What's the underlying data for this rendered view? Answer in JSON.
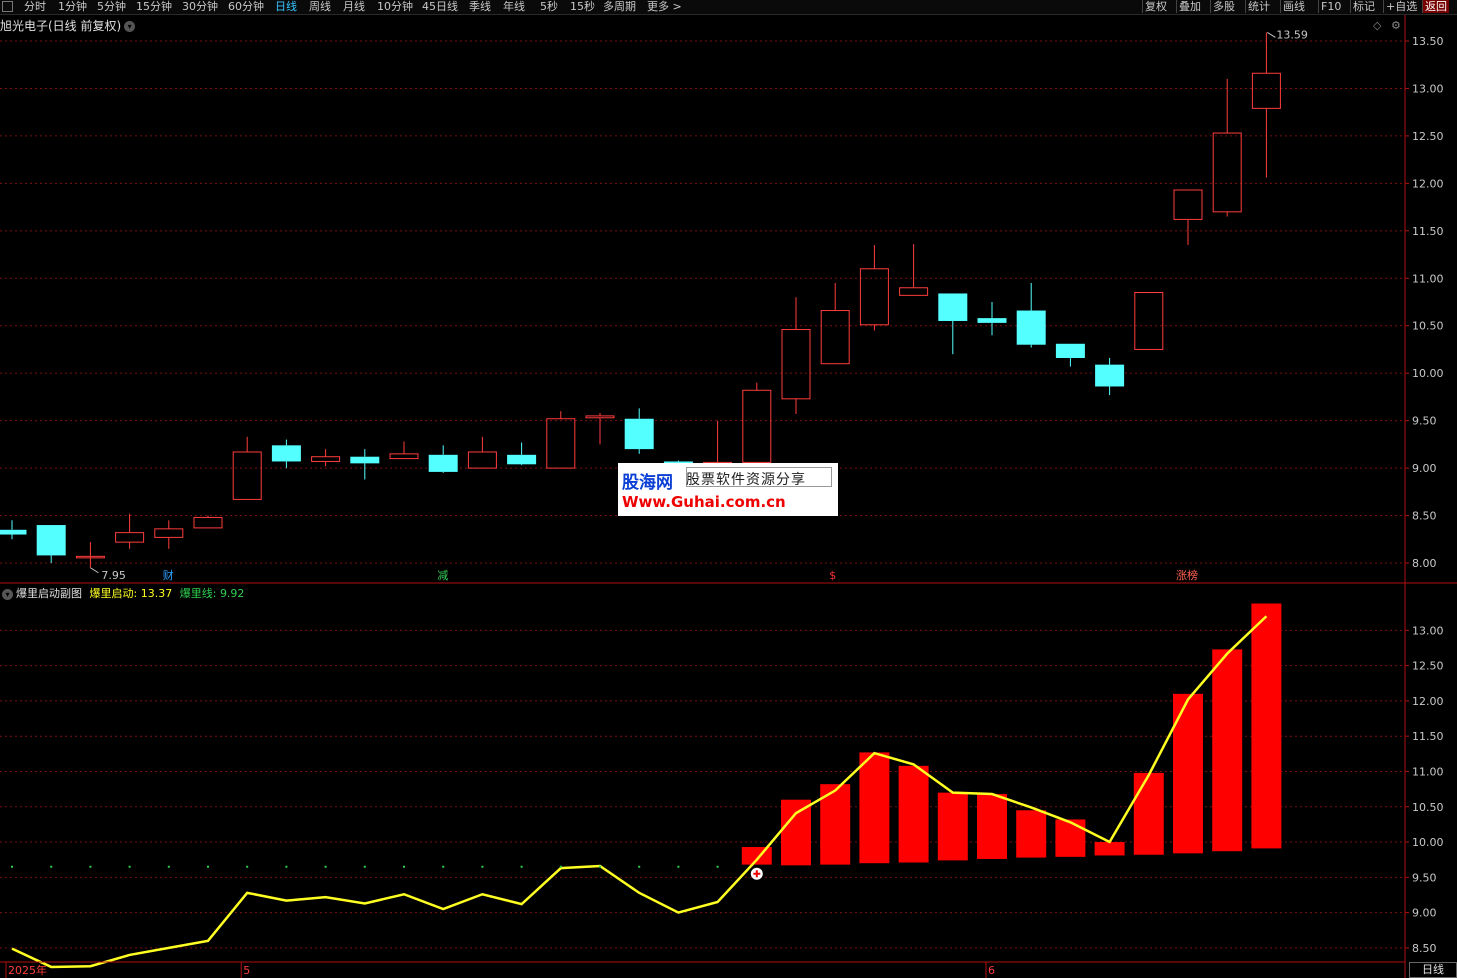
{
  "toolbar": {
    "periods": [
      "分时",
      "1分钟",
      "5分钟",
      "15分钟",
      "30分钟",
      "60分钟",
      "日线",
      "周线",
      "月线",
      "10分钟",
      "45日线",
      "季线",
      "年线",
      "5秒",
      "15秒",
      "多周期",
      "更多 >"
    ],
    "active_period": "日线",
    "right_tools": [
      "复权",
      "叠加",
      "多股",
      "统计",
      "画线",
      "F10",
      "标记",
      "+自选",
      "返回"
    ]
  },
  "main": {
    "title": "旭光电子(日线 前复权)",
    "high_marker": "13.59",
    "low_marker": "7.95",
    "event_markers": [
      {
        "label": "财",
        "color": "#2fa0ff",
        "index": 4
      },
      {
        "label": "减",
        "color": "#2fcc55",
        "index": 11
      },
      {
        "label": "$",
        "color": "#ff3030",
        "index": 21
      },
      {
        "label": "涨榜",
        "color": "#ff6050",
        "index": 30
      }
    ]
  },
  "sub": {
    "title": "爆里启动副图",
    "line1_label": "爆里启动:",
    "line1_value": "13.37",
    "line2_label": "爆里线:",
    "line2_value": "9.92"
  },
  "x_axis": {
    "labels": [
      {
        "text": "2025年",
        "index": 0
      },
      {
        "text": "5",
        "index": 6
      },
      {
        "text": "6",
        "index": 25
      }
    ],
    "period_button": "日线"
  },
  "watermark": {
    "logo": "股海网",
    "subtitle": "股票软件资源分享",
    "url": "Www.Guhai.com.cn"
  },
  "colors": {
    "up": "#ff3c3c",
    "down": "#54ffff",
    "grid": "#7a1010",
    "line": "#ffff22",
    "bar": "#ff0000",
    "dots": "#2fd04f"
  },
  "chart_data": [
    {
      "type": "candlestick",
      "title": "旭光电子(日线 前复权)",
      "ylim": [
        7.8,
        13.7
      ],
      "yticks": [
        8.0,
        8.5,
        9.0,
        9.5,
        10.0,
        10.5,
        11.0,
        11.5,
        12.0,
        12.5,
        13.0,
        13.5
      ],
      "candles": [
        {
          "o": 8.35,
          "h": 8.45,
          "l": 8.25,
          "c": 8.3
        },
        {
          "o": 8.4,
          "h": 8.4,
          "l": 8.0,
          "c": 8.08
        },
        {
          "o": 8.07,
          "h": 8.22,
          "l": 7.95,
          "c": 8.07
        },
        {
          "o": 8.22,
          "h": 8.52,
          "l": 8.15,
          "c": 8.32
        },
        {
          "o": 8.27,
          "h": 8.45,
          "l": 8.15,
          "c": 8.36
        },
        {
          "o": 8.37,
          "h": 8.5,
          "l": 8.37,
          "c": 8.48
        },
        {
          "o": 8.67,
          "h": 9.33,
          "l": 8.67,
          "c": 9.17
        },
        {
          "o": 9.24,
          "h": 9.3,
          "l": 9.0,
          "c": 9.07
        },
        {
          "o": 9.07,
          "h": 9.2,
          "l": 9.02,
          "c": 9.12
        },
        {
          "o": 9.12,
          "h": 9.2,
          "l": 8.88,
          "c": 9.05
        },
        {
          "o": 9.1,
          "h": 9.28,
          "l": 9.1,
          "c": 9.15
        },
        {
          "o": 9.14,
          "h": 9.24,
          "l": 8.95,
          "c": 8.96
        },
        {
          "o": 9.0,
          "h": 9.33,
          "l": 9.0,
          "c": 9.17
        },
        {
          "o": 9.14,
          "h": 9.27,
          "l": 9.03,
          "c": 9.04
        },
        {
          "o": 9.0,
          "h": 9.6,
          "l": 9.0,
          "c": 9.52
        },
        {
          "o": 9.53,
          "h": 9.58,
          "l": 9.25,
          "c": 9.55
        },
        {
          "o": 9.52,
          "h": 9.63,
          "l": 9.15,
          "c": 9.2
        },
        {
          "o": 9.07,
          "h": 9.08,
          "l": 8.94,
          "c": 9.01
        },
        {
          "o": 9.0,
          "h": 9.5,
          "l": 9.0,
          "c": 9.06
        },
        {
          "o": 9.06,
          "h": 9.9,
          "l": 9.06,
          "c": 9.82
        },
        {
          "o": 9.73,
          "h": 10.8,
          "l": 9.57,
          "c": 10.46
        },
        {
          "o": 10.1,
          "h": 10.95,
          "l": 10.1,
          "c": 10.66
        },
        {
          "o": 10.51,
          "h": 11.35,
          "l": 10.45,
          "c": 11.1
        },
        {
          "o": 10.82,
          "h": 11.36,
          "l": 10.82,
          "c": 10.9
        },
        {
          "o": 10.84,
          "h": 10.84,
          "l": 10.2,
          "c": 10.55
        },
        {
          "o": 10.58,
          "h": 10.75,
          "l": 10.4,
          "c": 10.53
        },
        {
          "o": 10.66,
          "h": 10.95,
          "l": 10.27,
          "c": 10.3
        },
        {
          "o": 10.31,
          "h": 10.31,
          "l": 10.07,
          "c": 10.16
        },
        {
          "o": 10.09,
          "h": 10.16,
          "l": 9.77,
          "c": 9.86
        },
        {
          "o": 10.25,
          "h": 10.85,
          "l": 10.25,
          "c": 10.85
        },
        {
          "o": 11.62,
          "h": 11.93,
          "l": 11.35,
          "c": 11.93
        },
        {
          "o": 11.7,
          "h": 13.1,
          "l": 11.65,
          "c": 12.53
        },
        {
          "o": 12.79,
          "h": 13.59,
          "l": 12.06,
          "c": 13.16
        }
      ]
    },
    {
      "type": "bar+line",
      "title": "爆里启动副图",
      "ylim": [
        8.3,
        13.6
      ],
      "yticks": [
        8.5,
        9.0,
        9.5,
        10.0,
        10.5,
        11.0,
        11.5,
        12.0,
        12.5,
        13.0
      ],
      "series": [
        {
          "name": "爆里启动",
          "type": "line",
          "values": [
            8.49,
            8.23,
            8.24,
            8.4,
            8.5,
            8.6,
            9.28,
            9.17,
            9.22,
            9.13,
            9.26,
            9.05,
            9.26,
            9.12,
            9.63,
            9.66,
            9.28,
            9.0,
            9.15,
            9.75,
            10.41,
            10.73,
            11.26,
            11.1,
            10.7,
            10.68,
            10.49,
            10.28,
            10.0,
            10.95,
            12.02,
            12.67,
            13.2
          ]
        },
        {
          "name": "爆里线",
          "type": "dots",
          "values": [
            9.65,
            9.65,
            9.65,
            9.65,
            9.65,
            9.65,
            9.65,
            9.65,
            9.65,
            9.65,
            9.65,
            9.65,
            9.65,
            9.65,
            9.65,
            9.65,
            9.65,
            9.65,
            9.65
          ]
        },
        {
          "name": "bars",
          "type": "bar",
          "bars": [
            {
              "index": 19,
              "bottom": 9.68,
              "top": 9.93
            },
            {
              "index": 20,
              "bottom": 9.67,
              "top": 10.6
            },
            {
              "index": 21,
              "bottom": 9.68,
              "top": 10.82
            },
            {
              "index": 22,
              "bottom": 9.7,
              "top": 11.27
            },
            {
              "index": 23,
              "bottom": 9.71,
              "top": 11.08
            },
            {
              "index": 24,
              "bottom": 9.74,
              "top": 10.7
            },
            {
              "index": 25,
              "bottom": 9.76,
              "top": 10.68
            },
            {
              "index": 26,
              "bottom": 9.78,
              "top": 10.45
            },
            {
              "index": 27,
              "bottom": 9.79,
              "top": 10.32
            },
            {
              "index": 28,
              "bottom": 9.81,
              "top": 10.0
            },
            {
              "index": 29,
              "bottom": 9.82,
              "top": 10.98
            },
            {
              "index": 30,
              "bottom": 9.84,
              "top": 12.1
            },
            {
              "index": 31,
              "bottom": 9.87,
              "top": 12.73
            },
            {
              "index": 32,
              "bottom": 9.91,
              "top": 13.38
            }
          ]
        }
      ]
    }
  ]
}
